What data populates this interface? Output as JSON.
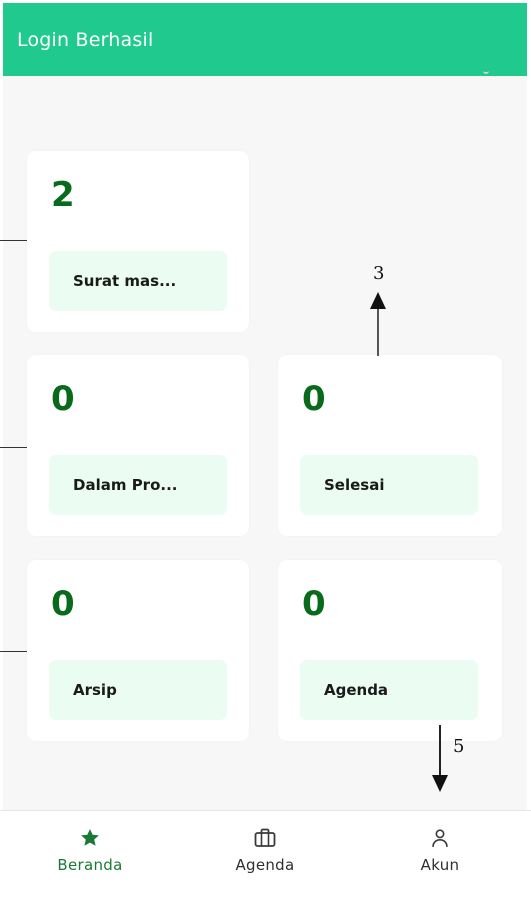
{
  "app_bar": {
    "title": "Login Berhasil"
  },
  "cards": [
    {
      "count": "2",
      "label": "Surat mas..."
    },
    {
      "count": "0",
      "label": "Dalam Pro..."
    },
    {
      "count": "0",
      "label": "Selesai"
    },
    {
      "count": "0",
      "label": "Arsip"
    },
    {
      "count": "0",
      "label": "Agenda"
    }
  ],
  "annotations": {
    "up_label": "3",
    "down_label": "5"
  },
  "bottom_nav": {
    "items": [
      {
        "label": "Beranda",
        "icon": "star-icon",
        "active": true
      },
      {
        "label": "Agenda",
        "icon": "briefcase-icon",
        "active": false
      },
      {
        "label": "Akun",
        "icon": "user-icon",
        "active": false
      }
    ]
  },
  "colors": {
    "app_bar": "#20c98e",
    "count_text": "#0a6a1c",
    "label_bg": "#ebfdf2",
    "nav_active": "#1a7a34",
    "page_bg": "#f7f7f7"
  }
}
